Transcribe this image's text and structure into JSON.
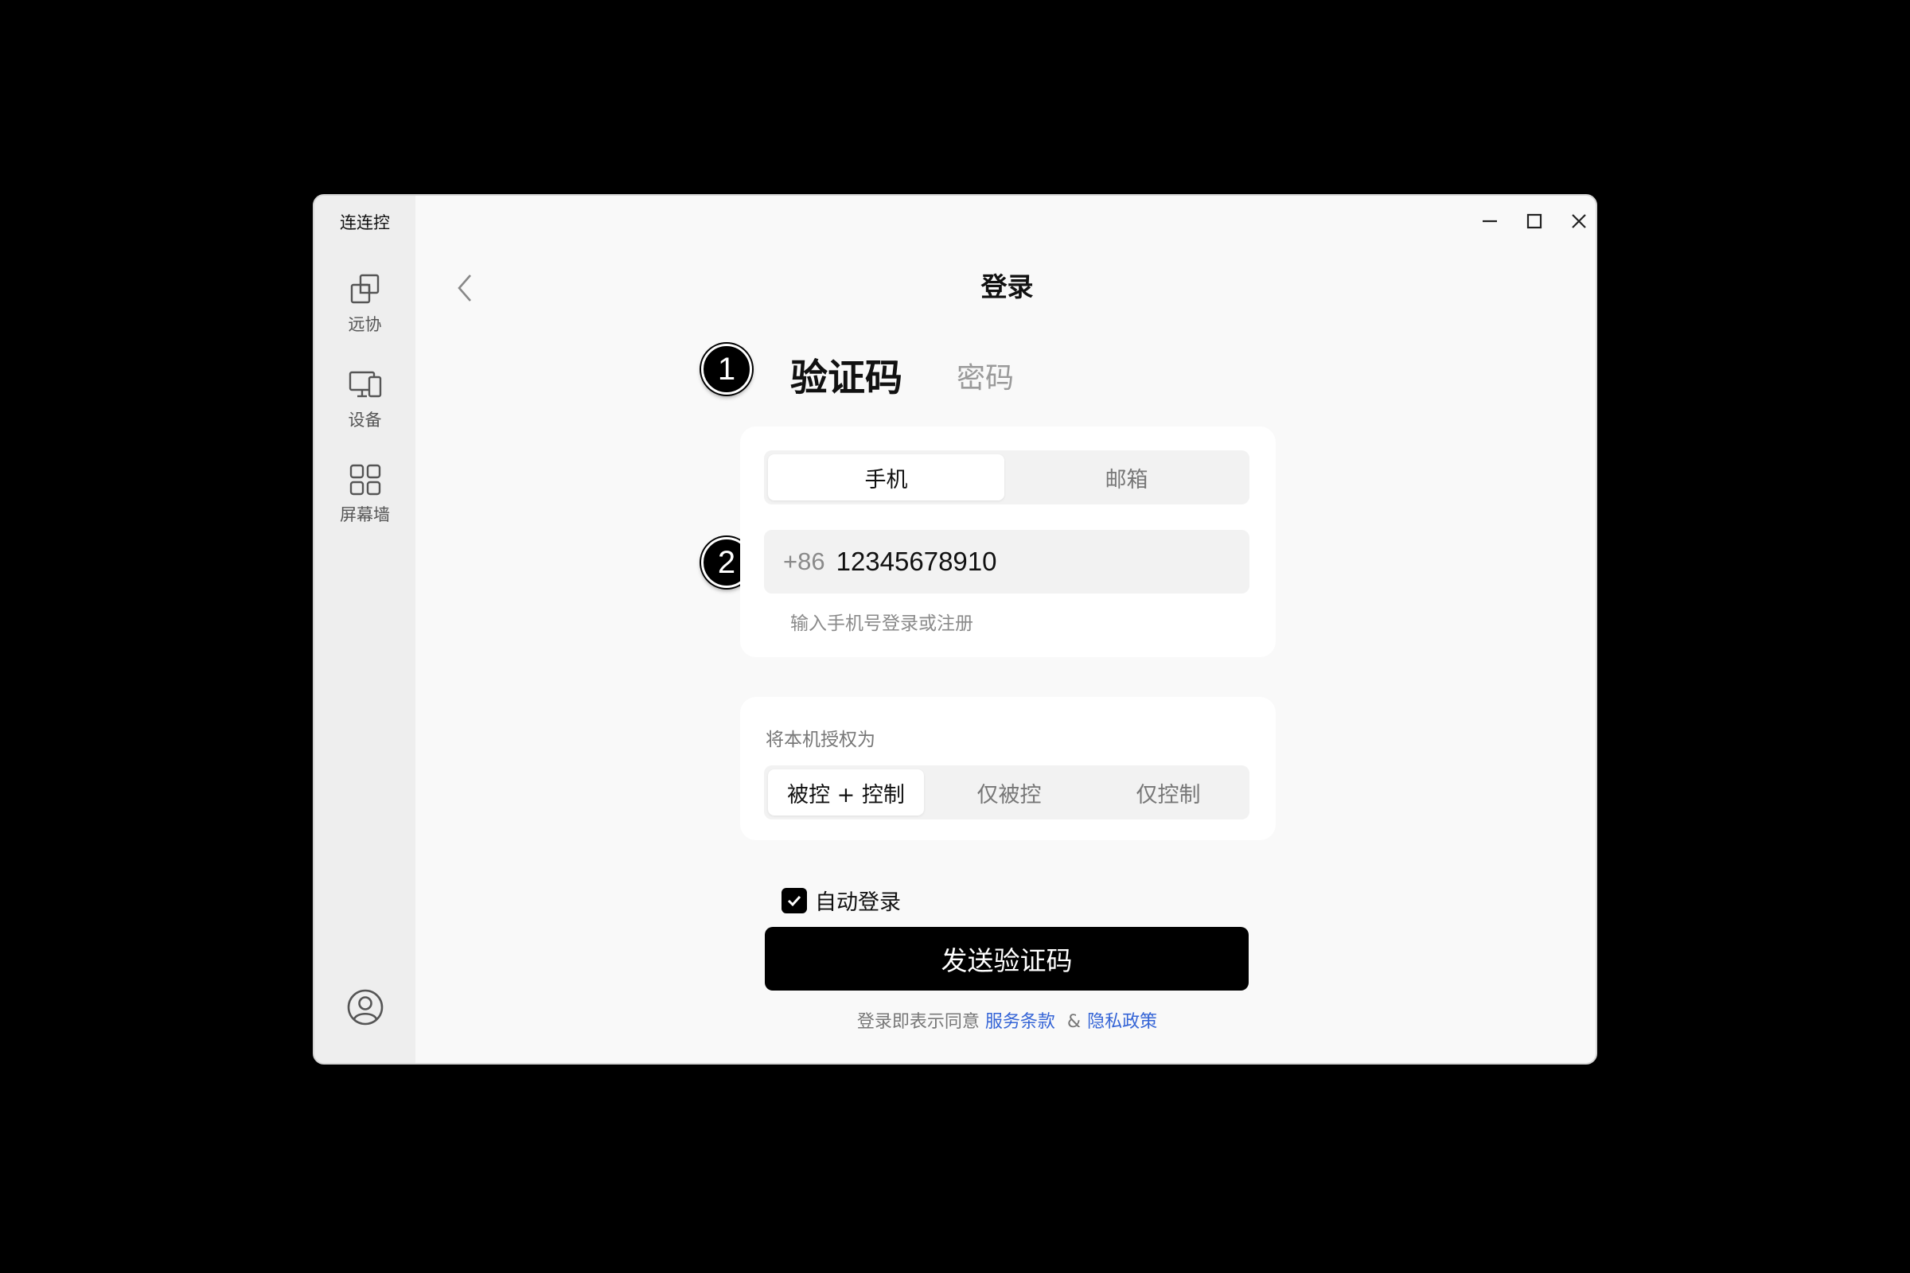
{
  "app": {
    "title": "连连控"
  },
  "sidebar": {
    "items": [
      {
        "label": "远协",
        "icon": "remote-assist-icon"
      },
      {
        "label": "设备",
        "icon": "devices-icon"
      },
      {
        "label": "屏幕墙",
        "icon": "screen-wall-icon"
      }
    ],
    "user_icon": "user-avatar-icon"
  },
  "window_controls": {
    "icons": [
      "minimize-icon",
      "maximize-icon",
      "close-icon"
    ]
  },
  "header": {
    "title": "登录",
    "back_icon": "chevron-left-icon"
  },
  "annotations": {
    "badge_1": "1",
    "badge_2": "2"
  },
  "login_modes": {
    "active": "验证码",
    "inactive": "密码"
  },
  "account_type": {
    "options": [
      "手机",
      "邮箱"
    ],
    "selected": "手机"
  },
  "phone": {
    "country_code": "+86",
    "value": "12345678910",
    "hint": "输入手机号登录或注册"
  },
  "authorization": {
    "label": "将本机授权为",
    "options": [
      "被控 + 控制",
      "仅被控",
      "仅控制"
    ],
    "selected": "被控 + 控制"
  },
  "auto_login": {
    "label": "自动登录",
    "checked": true
  },
  "submit": {
    "label": "发送验证码"
  },
  "terms": {
    "prefix": "登录即表示同意",
    "service_link": "服务条款",
    "separator": "&",
    "privacy_link": "隐私政策"
  },
  "colors": {
    "background": "#000000",
    "window": "#f9f9f9",
    "sidebar": "#eeeeee",
    "primary_button": "#000000",
    "link": "#3464d6"
  }
}
